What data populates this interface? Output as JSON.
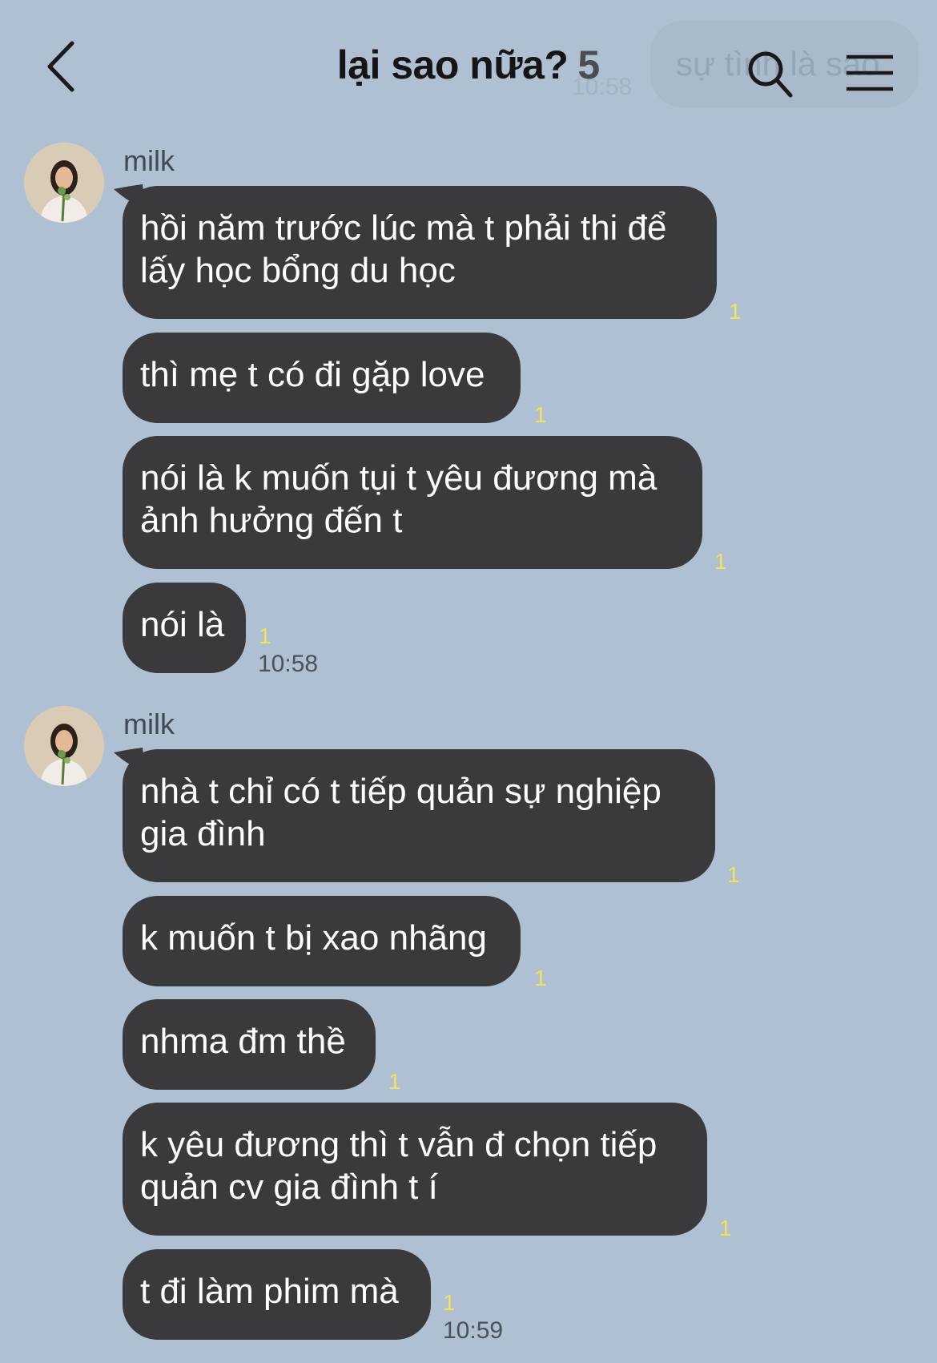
{
  "header": {
    "title": "lại sao nữa?",
    "member_count": "5",
    "ghost_message": "sự tình là sao",
    "ghost_time": "10:58"
  },
  "groups": [
    {
      "sender": "milk",
      "messages": [
        {
          "text": "hồi năm trước lúc mà t phải thi để\nlấy học bổng du học",
          "unread": "1"
        },
        {
          "text": "thì mẹ t có đi gặp love",
          "unread": "1"
        },
        {
          "text": "nói là k muốn tụi t yêu đương mà\nảnh hưởng đến t",
          "unread": "1"
        },
        {
          "text": "nói là",
          "unread": "1"
        }
      ],
      "time": "10:58"
    },
    {
      "sender": "milk",
      "messages": [
        {
          "text": "nhà t chỉ có t tiếp quản sự nghiệp\ngia đình",
          "unread": "1"
        },
        {
          "text": "k muốn t bị xao nhãng",
          "unread": "1"
        },
        {
          "text": "nhma đm thề",
          "unread": "1"
        },
        {
          "text": "k yêu đương thì t vẫn đ chọn tiếp\nquản cv gia đình t í",
          "unread": "1"
        },
        {
          "text": "t đi làm phim mà",
          "unread": "1"
        }
      ],
      "time": "10:59"
    }
  ],
  "colors": {
    "background": "#aec0d1",
    "bubble": "#3a3a3d",
    "bubble_text": "#ffffff",
    "unread_count": "#f2e35a"
  },
  "icons": [
    "back-chevron-icon",
    "search-icon",
    "menu-icon",
    "avatar-photo"
  ]
}
